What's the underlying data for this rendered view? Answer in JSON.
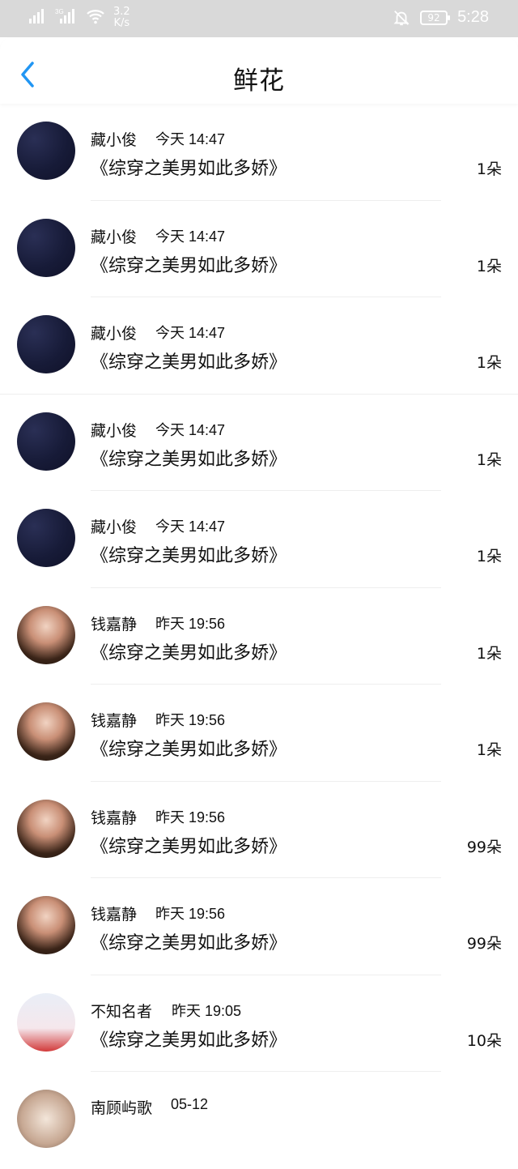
{
  "status_bar": {
    "net_speed_value": "3.2",
    "net_speed_unit": "K/s",
    "battery": "92",
    "time": "5:28"
  },
  "header": {
    "title": "鲜花"
  },
  "colors": {
    "accent": "#2196f3",
    "status_bar_bg": "#d9d9d9"
  },
  "items": [
    {
      "name": "藏小俊",
      "time": "今天 14:47",
      "book": "《综穿之美男如此多娇》",
      "count": "1朵",
      "avatar": "night"
    },
    {
      "name": "藏小俊",
      "time": "今天 14:47",
      "book": "《综穿之美男如此多娇》",
      "count": "1朵",
      "avatar": "night"
    },
    {
      "name": "藏小俊",
      "time": "今天 14:47",
      "book": "《综穿之美男如此多娇》",
      "count": "1朵",
      "avatar": "night"
    },
    {
      "name": "藏小俊",
      "time": "今天 14:47",
      "book": "《综穿之美男如此多娇》",
      "count": "1朵",
      "avatar": "night"
    },
    {
      "name": "藏小俊",
      "time": "今天 14:47",
      "book": "《综穿之美男如此多娇》",
      "count": "1朵",
      "avatar": "night"
    },
    {
      "name": "钱嘉静",
      "time": "昨天 19:56",
      "book": "《综穿之美男如此多娇》",
      "count": "1朵",
      "avatar": "portrait"
    },
    {
      "name": "钱嘉静",
      "time": "昨天 19:56",
      "book": "《综穿之美男如此多娇》",
      "count": "1朵",
      "avatar": "portrait"
    },
    {
      "name": "钱嘉静",
      "time": "昨天 19:56",
      "book": "《综穿之美男如此多娇》",
      "count": "99朵",
      "avatar": "portrait"
    },
    {
      "name": "钱嘉静",
      "time": "昨天 19:56",
      "book": "《综穿之美男如此多娇》",
      "count": "99朵",
      "avatar": "portrait"
    },
    {
      "name": "不知名者",
      "time": "昨天 19:05",
      "book": "《综穿之美男如此多娇》",
      "count": "10朵",
      "avatar": "anime"
    },
    {
      "name": "南顾屿歌",
      "time": "05-12",
      "book": "",
      "count": "",
      "avatar": "photo"
    }
  ]
}
